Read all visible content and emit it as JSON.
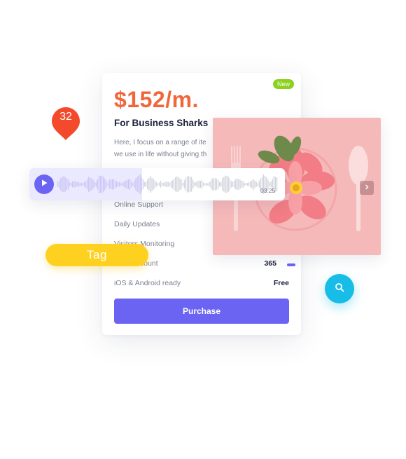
{
  "pricing_card": {
    "badge": "New",
    "price": "$152/m.",
    "plan_name": "For Business Sharks",
    "description_line1": "Here, I focus on a range of ite",
    "description_line2": "we use in life without giving th",
    "features": [
      {
        "label": "Online Support",
        "value": ""
      },
      {
        "label": "Daily Updates",
        "value": ""
      },
      {
        "label": "Visitors Monitoring",
        "value": ""
      },
      {
        "label": "count",
        "value": "365"
      },
      {
        "label": "iOS & Android ready",
        "value": "Free"
      }
    ],
    "purchase_label": "Purchase"
  },
  "audio_player": {
    "time": "03:25",
    "progress": 0.44
  },
  "notification_pin": {
    "count": "32"
  },
  "tag_chip": {
    "label": "Tag"
  },
  "colors": {
    "accent": "#6b63f2",
    "price": "#f0673c",
    "badge_new": "#8bd11e",
    "pin": "#f24a2b",
    "tag": "#fed121",
    "search": "#17bde6",
    "photo_bg": "#f6b9ba"
  },
  "icons": [
    "play-icon",
    "chevron-right-icon",
    "search-icon",
    "map-pin-icon"
  ]
}
